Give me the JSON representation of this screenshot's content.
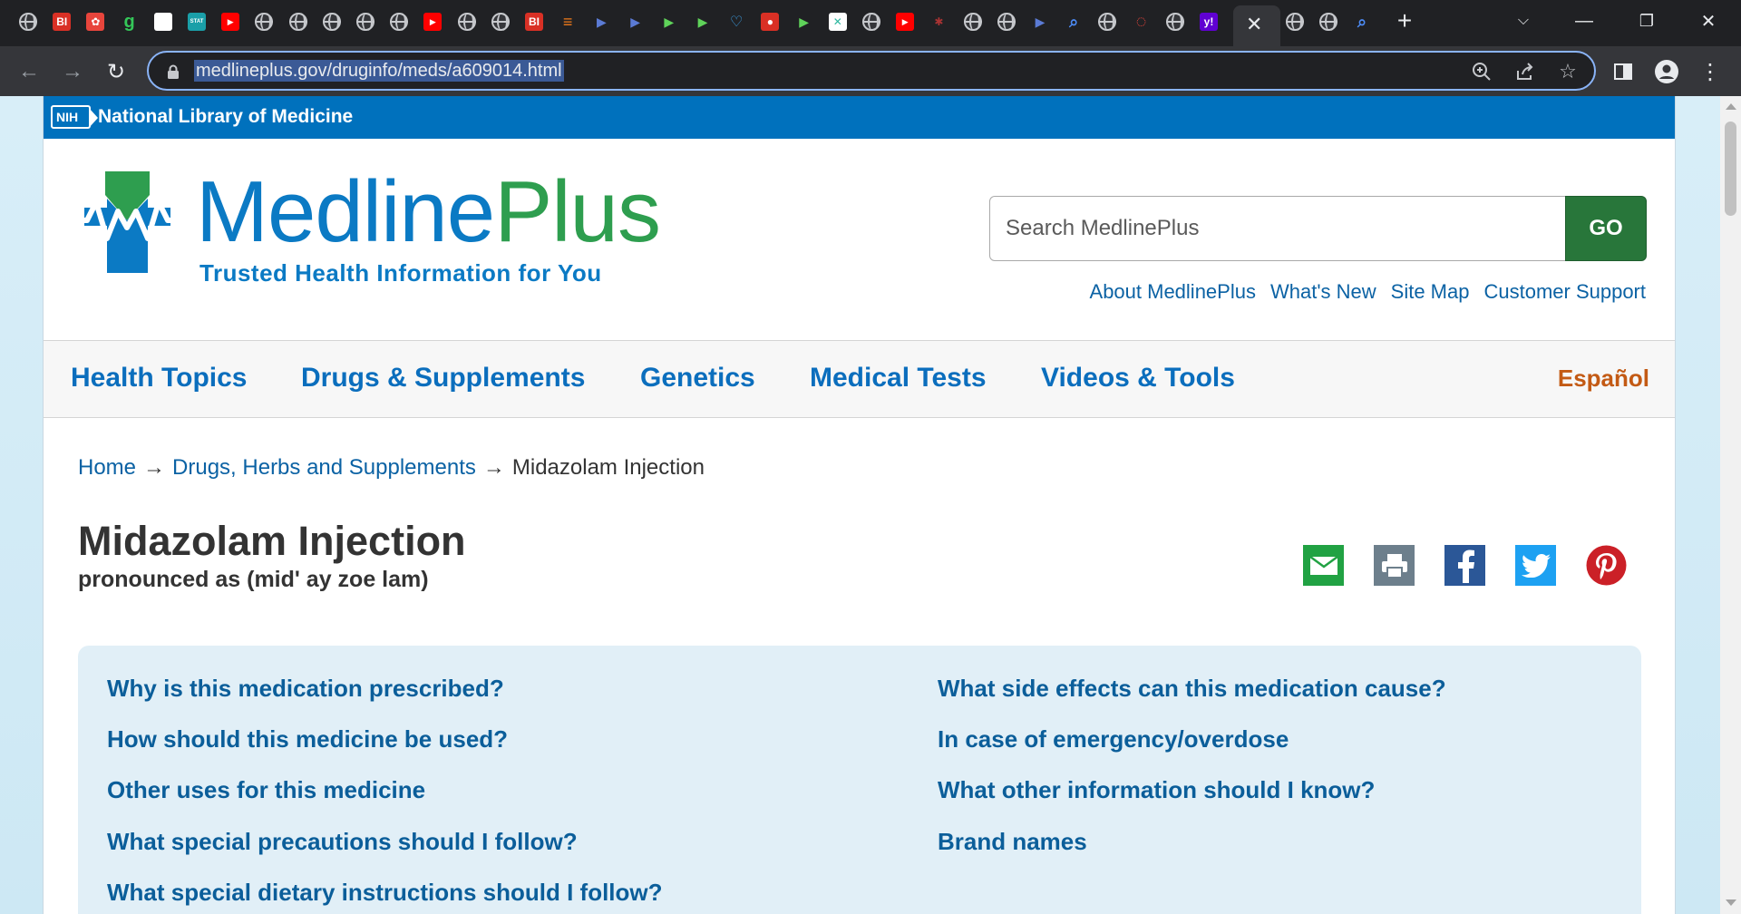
{
  "browser": {
    "url": "medlineplus.gov/druginfo/meds/a609014.html",
    "tabs": [
      {
        "icon": "globe-icon",
        "kind": "globe"
      },
      {
        "icon": "business-insider-icon",
        "kind": "bi",
        "text": "BI"
      },
      {
        "icon": "pinwheel-icon",
        "kind": "pin"
      },
      {
        "icon": "g-icon",
        "kind": "g",
        "text": "g"
      },
      {
        "icon": "blank-page-icon",
        "kind": "white"
      },
      {
        "icon": "stat-icon",
        "kind": "stat",
        "text": "STAT"
      },
      {
        "icon": "youtube-icon",
        "kind": "yt"
      },
      {
        "icon": "globe-icon",
        "kind": "globe"
      },
      {
        "icon": "globe-icon",
        "kind": "globe"
      },
      {
        "icon": "globe-icon",
        "kind": "globe"
      },
      {
        "icon": "globe-icon",
        "kind": "globe"
      },
      {
        "icon": "globe-icon",
        "kind": "globe"
      },
      {
        "icon": "youtube-icon",
        "kind": "yt"
      },
      {
        "icon": "globe-icon",
        "kind": "globe"
      },
      {
        "icon": "globe-icon",
        "kind": "globe"
      },
      {
        "icon": "business-insider-icon",
        "kind": "bi",
        "text": "BI"
      },
      {
        "icon": "bookmark-icon",
        "kind": "orange"
      },
      {
        "icon": "arrow-tab-icon",
        "kind": "chev"
      },
      {
        "icon": "arrow-tab-icon",
        "kind": "chev"
      },
      {
        "icon": "play-icon",
        "kind": "play"
      },
      {
        "icon": "play-icon",
        "kind": "play"
      },
      {
        "icon": "heart-icon",
        "kind": "heart"
      },
      {
        "icon": "microphone-icon",
        "kind": "mic"
      },
      {
        "icon": "play-icon",
        "kind": "play"
      },
      {
        "icon": "puzzle-icon",
        "kind": "puzzle"
      },
      {
        "icon": "globe-icon",
        "kind": "globe"
      },
      {
        "icon": "youtube-icon",
        "kind": "yt"
      },
      {
        "icon": "bug-icon",
        "kind": "bug"
      },
      {
        "icon": "globe-icon",
        "kind": "globe"
      },
      {
        "icon": "globe-icon",
        "kind": "globe"
      },
      {
        "icon": "arrow-tab-icon",
        "kind": "chev"
      },
      {
        "icon": "search-tab-icon",
        "kind": "search"
      },
      {
        "icon": "globe-icon",
        "kind": "globe"
      },
      {
        "icon": "refresh-red-icon",
        "kind": "red"
      },
      {
        "icon": "globe-icon",
        "kind": "globe"
      },
      {
        "icon": "yahoo-icon",
        "kind": "yahoo",
        "text": "y!"
      }
    ],
    "after_tabs": [
      {
        "icon": "globe-icon",
        "kind": "globe"
      },
      {
        "icon": "globe-icon",
        "kind": "globe"
      },
      {
        "icon": "search-tab-icon",
        "kind": "search"
      }
    ]
  },
  "nlm": {
    "badge": "NIH",
    "title": "National Library of Medicine"
  },
  "header": {
    "brand_left": "Medline",
    "brand_right": "Plus",
    "tagline": "Trusted Health Information for You",
    "search_placeholder": "Search MedlinePlus",
    "go_label": "GO",
    "utility_links": [
      "About MedlinePlus",
      "What's New",
      "Site Map",
      "Customer Support"
    ]
  },
  "nav": {
    "items": [
      "Health Topics",
      "Drugs & Supplements",
      "Genetics",
      "Medical Tests",
      "Videos & Tools"
    ],
    "espanol": "Español"
  },
  "breadcrumb": {
    "home": "Home",
    "section": "Drugs, Herbs and Supplements",
    "current": "Midazolam Injection",
    "separator": "→"
  },
  "article": {
    "title": "Midazolam Injection",
    "pronounced": "pronounced as (mid' ay zoe lam)"
  },
  "share": [
    {
      "icon": "email-icon",
      "color": "#21a243"
    },
    {
      "icon": "print-icon",
      "color": "#6d7f8c"
    },
    {
      "icon": "facebook-icon",
      "color": "#2b5797"
    },
    {
      "icon": "twitter-icon",
      "color": "#1da1f2"
    },
    {
      "icon": "pinterest-icon",
      "color": "#cb2027"
    }
  ],
  "toc": {
    "left": [
      "Why is this medication prescribed?",
      "How should this medicine be used?",
      "Other uses for this medicine",
      "What special precautions should I follow?",
      "What special dietary instructions should I follow?"
    ],
    "right": [
      "What side effects can this medication cause?",
      "In case of emergency/overdose",
      "What other information should I know?",
      "Brand names"
    ]
  }
}
